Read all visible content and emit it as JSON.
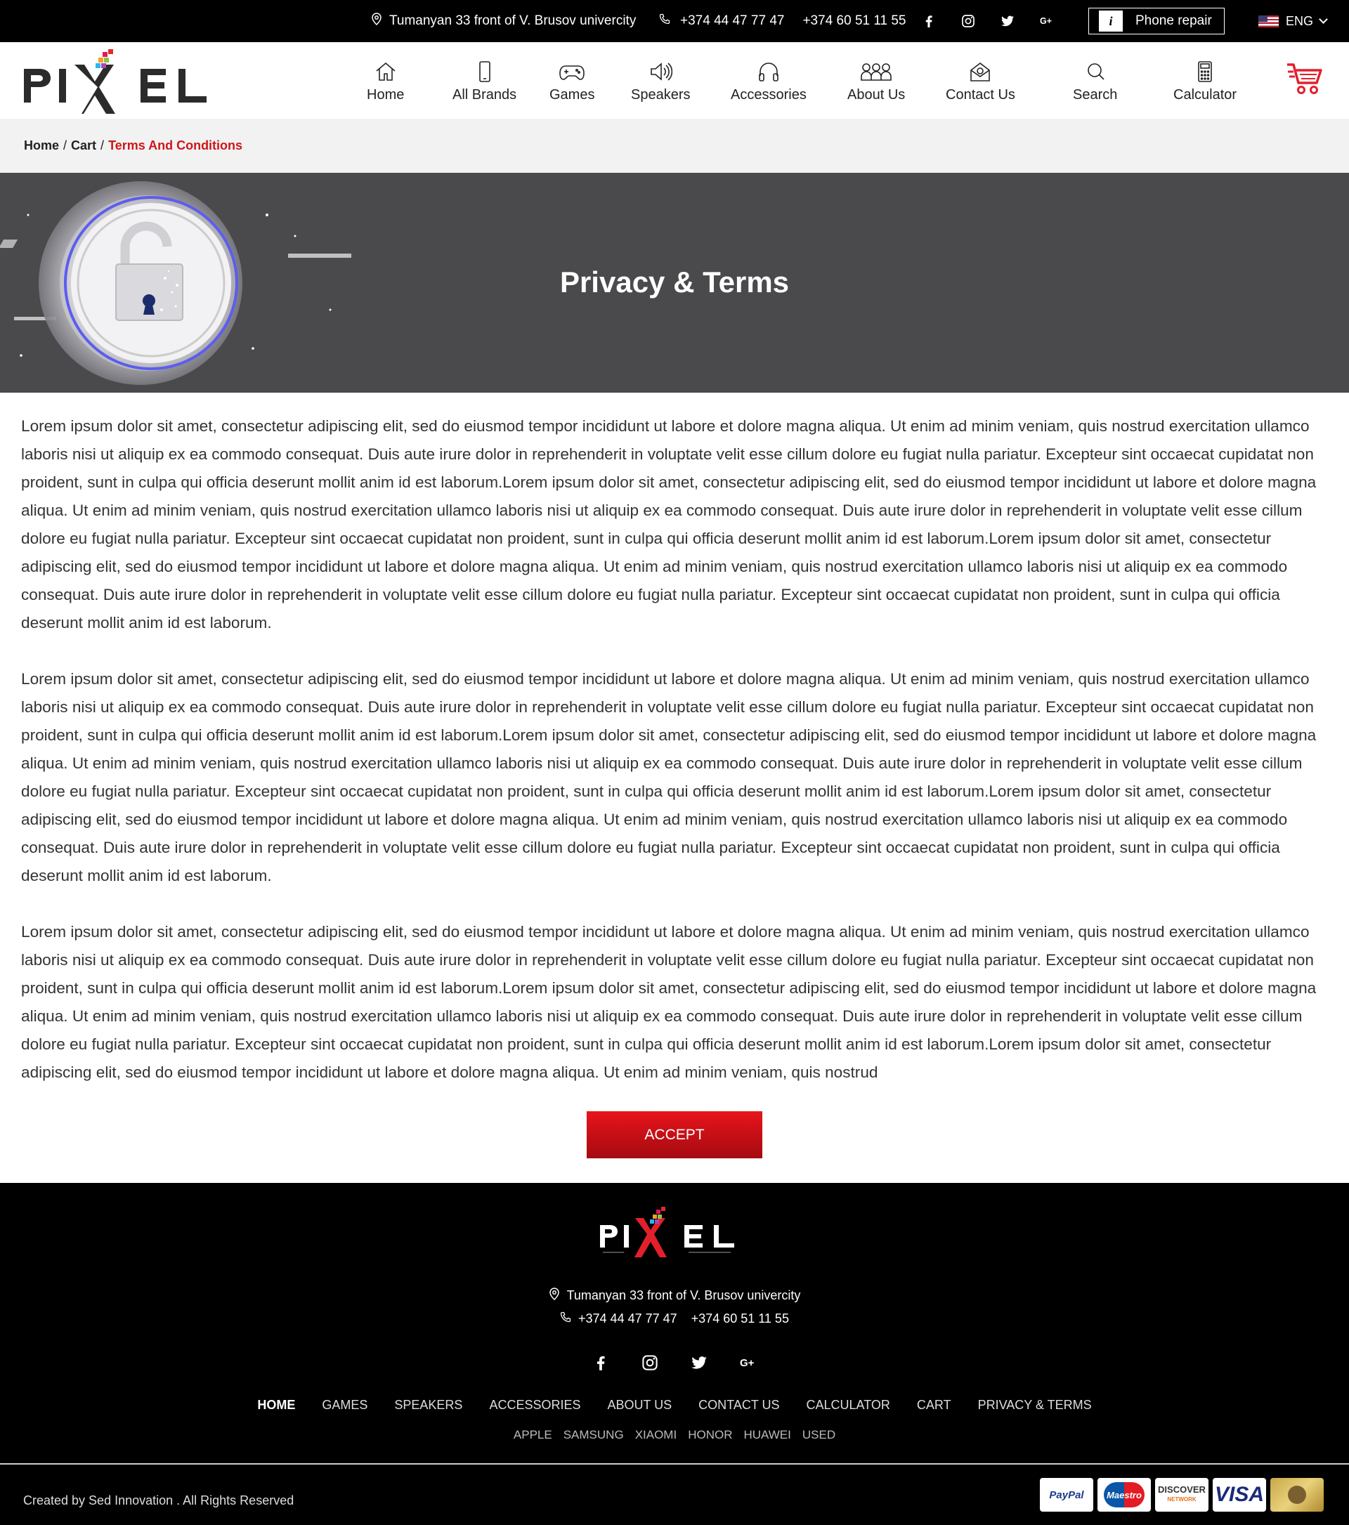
{
  "topbar": {
    "address": "Tumanyan 33 front of V. Brusov univercity",
    "phone1": "+374 44 47 77 47",
    "phone2": "+374 60 51 11 55",
    "repair_label": "Phone repair",
    "language": "ENG"
  },
  "nav": {
    "items": [
      {
        "label": "Home",
        "icon": "home-icon"
      },
      {
        "label": "All Brands",
        "icon": "smartphone-icon"
      },
      {
        "label": "Games",
        "icon": "gamepad-icon"
      },
      {
        "label": "Speakers",
        "icon": "speaker-icon"
      },
      {
        "label": "Accessories",
        "icon": "headphones-icon"
      },
      {
        "label": "About Us",
        "icon": "people-icon"
      },
      {
        "label": "Contact Us",
        "icon": "mail-icon"
      },
      {
        "label": "Search",
        "icon": "search-icon"
      },
      {
        "label": "Calculator",
        "icon": "calculator-icon"
      }
    ]
  },
  "breadcrumb": {
    "home": "Home",
    "cart": "Cart",
    "current": "Terms And Conditions"
  },
  "banner": {
    "title": "Privacy & Terms"
  },
  "content": {
    "paragraphs": [
      "Lorem ipsum dolor sit amet, consectetur adipiscing elit, sed do eiusmod tempor incididunt ut labore et dolore magna aliqua. Ut enim ad minim veniam, quis nostrud exercitation ullamco laboris nisi ut aliquip ex ea commodo consequat. Duis aute irure dolor in reprehenderit in voluptate velit esse cillum dolore eu fugiat nulla pariatur. Excepteur sint occaecat cupidatat non proident, sunt in culpa qui officia deserunt mollit anim id est laborum.Lorem ipsum dolor sit amet, consectetur adipiscing elit, sed do eiusmod tempor incididunt ut labore et dolore magna aliqua. Ut enim ad minim veniam, quis nostrud exercitation ullamco laboris nisi ut aliquip ex ea commodo consequat. Duis aute irure dolor in reprehenderit in voluptate velit esse cillum dolore eu fugiat nulla pariatur. Excepteur sint occaecat cupidatat non proident, sunt in culpa qui officia deserunt mollit anim id est laborum.Lorem ipsum dolor sit amet, consectetur adipiscing elit, sed do eiusmod tempor incididunt ut labore et dolore magna aliqua. Ut enim ad minim veniam, quis nostrud exercitation ullamco laboris nisi ut aliquip ex ea commodo consequat. Duis aute irure dolor in reprehenderit in voluptate velit esse cillum dolore eu fugiat nulla pariatur. Excepteur sint occaecat cupidatat non proident, sunt in culpa qui officia deserunt mollit anim id est laborum.",
      "Lorem ipsum dolor sit amet, consectetur adipiscing elit, sed do eiusmod tempor incididunt ut labore et dolore magna aliqua. Ut enim ad minim veniam, quis nostrud exercitation ullamco laboris nisi ut aliquip ex ea commodo consequat. Duis aute irure dolor in reprehenderit in voluptate velit esse cillum dolore eu fugiat nulla pariatur. Excepteur sint occaecat cupidatat non proident, sunt in culpa qui officia deserunt mollit anim id est laborum.Lorem ipsum dolor sit amet, consectetur adipiscing elit, sed do eiusmod tempor incididunt ut labore et dolore magna aliqua. Ut enim ad minim veniam, quis nostrud exercitation ullamco laboris nisi ut aliquip ex ea commodo consequat. Duis aute irure dolor in reprehenderit in voluptate velit esse cillum dolore eu fugiat nulla pariatur. Excepteur sint occaecat cupidatat non proident, sunt in culpa qui officia deserunt mollit anim id est laborum.Lorem ipsum dolor sit amet, consectetur adipiscing elit, sed do eiusmod tempor incididunt ut labore et dolore magna aliqua. Ut enim ad minim veniam, quis nostrud exercitation ullamco laboris nisi ut aliquip ex ea commodo consequat. Duis aute irure dolor in reprehenderit in voluptate velit esse cillum dolore eu fugiat nulla pariatur. Excepteur sint occaecat cupidatat non proident, sunt in culpa qui officia deserunt mollit anim id est laborum.",
      "Lorem ipsum dolor sit amet, consectetur adipiscing elit, sed do eiusmod tempor incididunt ut labore et dolore magna aliqua. Ut enim ad minim veniam, quis nostrud exercitation ullamco laboris nisi ut aliquip ex ea commodo consequat. Duis aute irure dolor in reprehenderit in voluptate velit esse cillum dolore eu fugiat nulla pariatur. Excepteur sint occaecat cupidatat non proident, sunt in culpa qui officia deserunt mollit anim id est laborum.Lorem ipsum dolor sit amet, consectetur adipiscing elit, sed do eiusmod tempor incididunt ut labore et dolore magna aliqua. Ut enim ad minim veniam, quis nostrud exercitation ullamco laboris nisi ut aliquip ex ea commodo consequat. Duis aute irure dolor in reprehenderit in voluptate velit esse cillum dolore eu fugiat nulla pariatur. Excepteur sint occaecat cupidatat non proident, sunt in culpa qui officia deserunt mollit anim id est laborum.Lorem ipsum dolor sit amet, consectetur adipiscing elit, sed do eiusmod tempor incididunt ut labore et dolore magna aliqua. Ut enim ad minim veniam, quis nostrud"
    ],
    "accept_label": "ACCEPT"
  },
  "footer": {
    "address": "Tumanyan 33 front of V. Brusov univercity",
    "phone1": "+374 44 47 77 47",
    "phone2": "+374 60 51 11 55",
    "menu": [
      "HOME",
      "GAMES",
      "SPEAKERS",
      "ACCESSORIES",
      "ABOUT US",
      "CONTACT US",
      "CALCULATOR",
      "CART",
      "PRIVACY & TERMS"
    ],
    "brands": [
      "APPLE",
      "SAMSUNG",
      "XIAOMI",
      "HONOR",
      "HUAWEI",
      "USED"
    ],
    "credit": "Created by Sed Innovation  .  All Rights Reserved",
    "payments": {
      "paypal": "PayPal",
      "maestro": "Maestro",
      "discover": "DISCOVER",
      "discover_sub": "NETWORK",
      "visa": "VISA"
    }
  },
  "colors": {
    "accent": "#d0151c",
    "banner_bg": "#4a4a4c",
    "topbar_bg": "#000000"
  }
}
